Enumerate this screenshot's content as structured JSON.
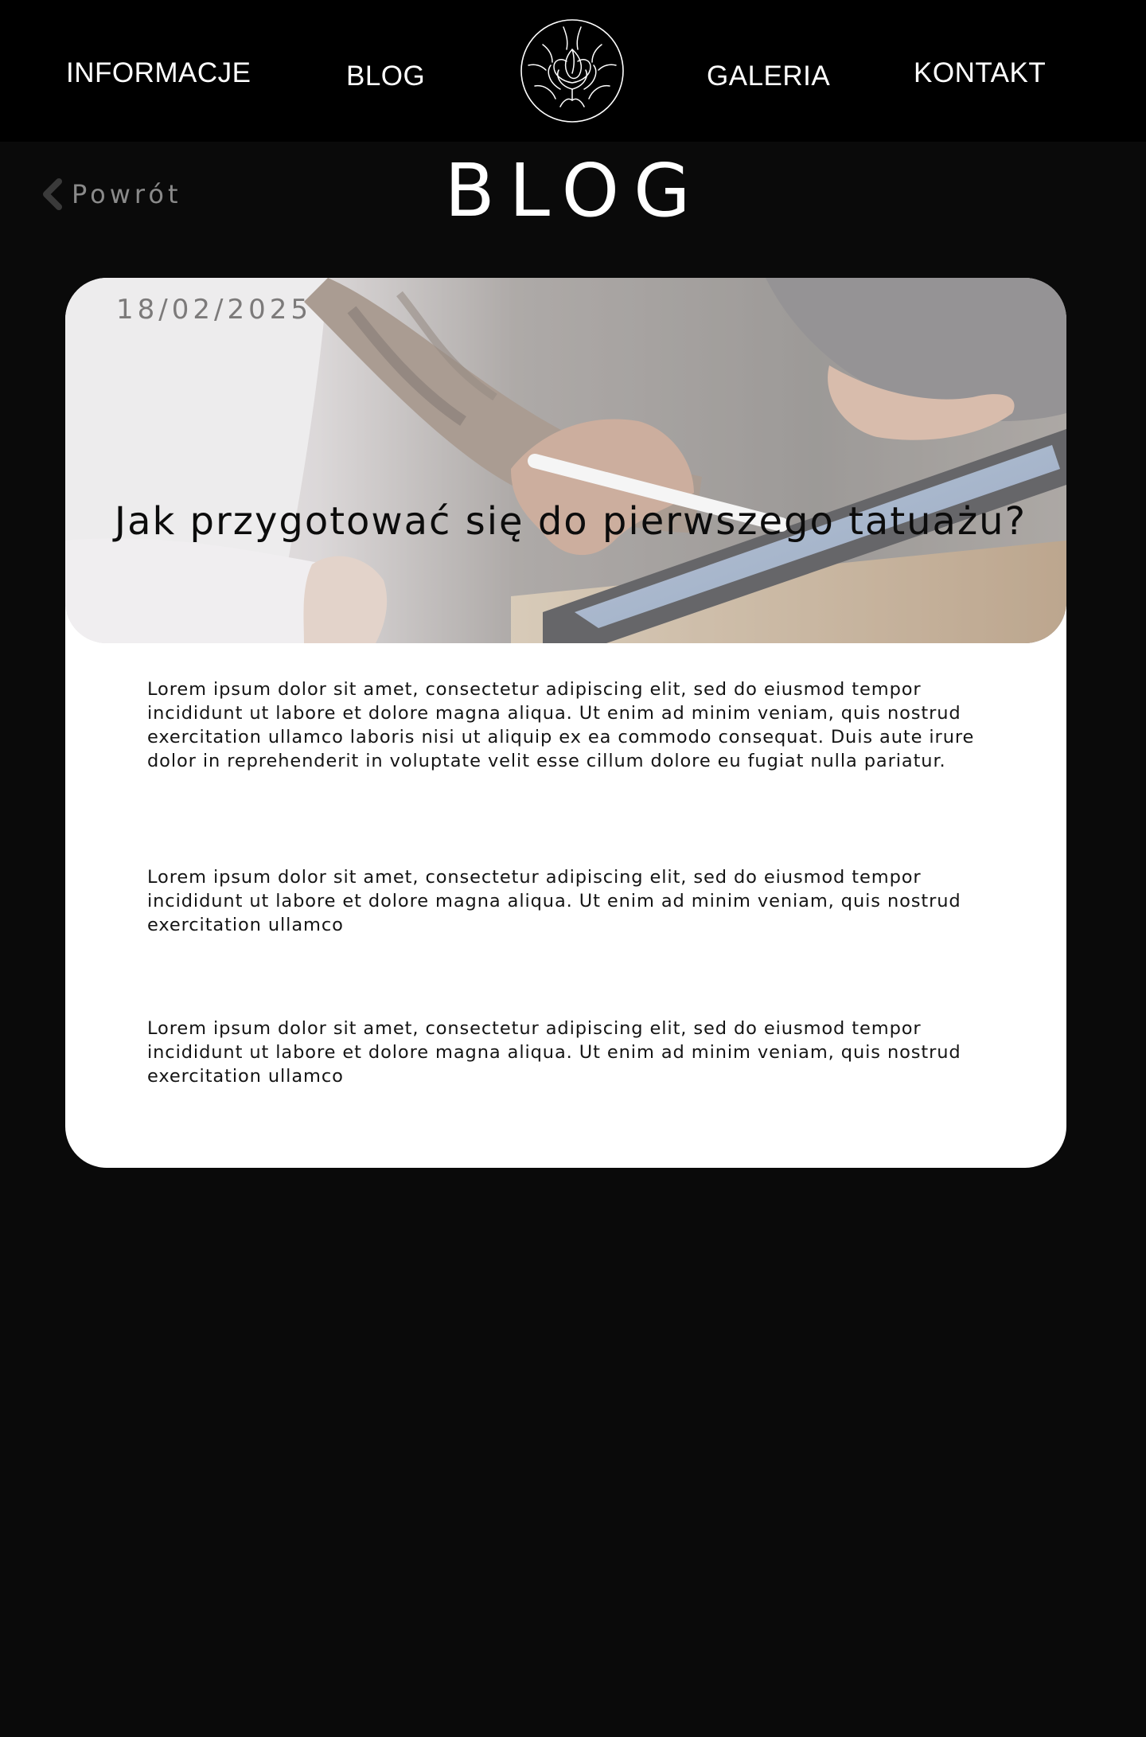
{
  "nav": {
    "items": [
      {
        "label": "INFORMACJE"
      },
      {
        "label": "BLOG"
      },
      {
        "label": "GALERIA"
      },
      {
        "label": "KONTAKT"
      }
    ],
    "logo_icon": "rose-emblem-icon"
  },
  "back": {
    "label": "Powrót",
    "icon": "chevron-left-icon"
  },
  "page": {
    "title": "BLOG"
  },
  "post": {
    "date": "18/02/2025",
    "title": "Jak przygotować się do pierwszego tatuażu?",
    "paragraphs": [
      "Lorem ipsum dolor sit amet, consectetur adipiscing elit, sed do eiusmod tempor incididunt ut labore et dolore magna aliqua. Ut enim ad minim veniam, quis nostrud exercitation ullamco laboris nisi ut aliquip ex ea commodo consequat. Duis aute irure dolor in reprehenderit in voluptate velit esse cillum dolore eu fugiat nulla pariatur.",
      "Lorem ipsum dolor sit amet, consectetur adipiscing elit, sed do eiusmod tempor incididunt ut labore et dolore magna aliqua. Ut enim ad minim veniam, quis nostrud exercitation ullamco",
      "Lorem ipsum dolor sit amet, consectetur adipiscing elit, sed do eiusmod tempor incididunt ut labore et dolore magna aliqua. Ut enim ad minim veniam, quis nostrud exercitation ullamco"
    ]
  },
  "colors": {
    "page_background": "#0a0a0a",
    "header_background": "#000000",
    "card_background": "#ffffff",
    "muted_text": "#8a8a8a"
  }
}
